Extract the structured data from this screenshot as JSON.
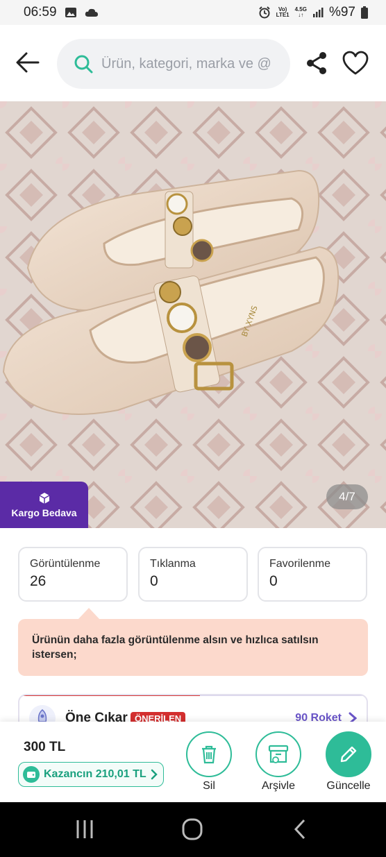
{
  "status_bar": {
    "time": "06:59",
    "network_top": "Vo)",
    "network_bottom": "LTE1",
    "net_type": "4.5G",
    "battery": "%97"
  },
  "header": {
    "search_placeholder": "Ürün, kategori, marka ve @"
  },
  "gallery": {
    "kargo_label": "Kargo Bedava",
    "counter": "4/7"
  },
  "stats": [
    {
      "label": "Görüntülenme",
      "value": "26"
    },
    {
      "label": "Tıklanma",
      "value": "0"
    },
    {
      "label": "Favorilenme",
      "value": "0"
    }
  ],
  "promo": {
    "text": "Ürünün daha fazla görüntülenme alsın ve hızlıca satılsın istersen;"
  },
  "boost": {
    "title": "Öne Çıkar",
    "badge": "ÖNERİLEN",
    "roket": "90 Roket"
  },
  "action_bar": {
    "price": "300 TL",
    "kazanc": "Kazancın 210,01 TL",
    "delete_label": "Sil",
    "archive_label": "Arşivle",
    "update_label": "Güncelle"
  },
  "colors": {
    "accent": "#2ebc98",
    "kargo_bg": "#5b2ba6",
    "promo_bg": "#fcd9cc",
    "badge_red": "#d32f2f"
  }
}
